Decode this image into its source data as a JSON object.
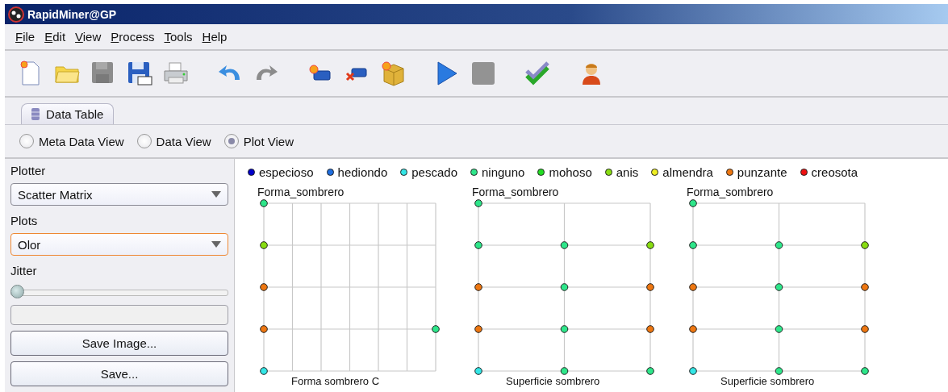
{
  "window": {
    "title": "RapidMiner@GP"
  },
  "menu": [
    {
      "label": "File"
    },
    {
      "label": "Edit"
    },
    {
      "label": "View"
    },
    {
      "label": "Process"
    },
    {
      "label": "Tools"
    },
    {
      "label": "Help"
    }
  ],
  "toolbar": [
    {
      "kind": "new",
      "disabled": false
    },
    {
      "kind": "open",
      "disabled": false
    },
    {
      "kind": "save",
      "disabled": true
    },
    {
      "kind": "saveas",
      "disabled": false
    },
    {
      "kind": "print",
      "disabled": false
    },
    {
      "kind": "gap"
    },
    {
      "kind": "undo",
      "disabled": false
    },
    {
      "kind": "redo",
      "disabled": true
    },
    {
      "kind": "gap"
    },
    {
      "kind": "newop",
      "disabled": false
    },
    {
      "kind": "delop",
      "disabled": false
    },
    {
      "kind": "box",
      "disabled": false
    },
    {
      "kind": "gap"
    },
    {
      "kind": "run",
      "disabled": false
    },
    {
      "kind": "stop",
      "disabled": true
    },
    {
      "kind": "gap"
    },
    {
      "kind": "check",
      "disabled": false
    },
    {
      "kind": "gap"
    },
    {
      "kind": "user",
      "disabled": false
    }
  ],
  "tabs": [
    {
      "label": "Data Table",
      "selected": true
    }
  ],
  "views": [
    {
      "label": "Meta Data View",
      "selected": false
    },
    {
      "label": "Data View",
      "selected": false
    },
    {
      "label": "Plot View",
      "selected": true
    }
  ],
  "sidebar": {
    "plotter_label": "Plotter",
    "plotter": "Scatter Matrix",
    "plots_label": "Plots",
    "plots": "Olor",
    "plots_focused": true,
    "jitter_label": "Jitter",
    "jitter": {
      "level": 0
    },
    "buttons": [
      "Save Image...",
      "Save..."
    ]
  },
  "legend": [
    {
      "label": "especioso",
      "color": "#0000cc"
    },
    {
      "label": "hediondo",
      "color": "#1e6ee0"
    },
    {
      "label": "pescado",
      "color": "#33e6e6"
    },
    {
      "label": "ninguno",
      "color": "#2ee68a"
    },
    {
      "label": "mohoso",
      "color": "#22dd22"
    },
    {
      "label": "anis",
      "color": "#88dd11"
    },
    {
      "label": "almendra",
      "color": "#eeee22"
    },
    {
      "label": "punzante",
      "color": "#ee7711"
    },
    {
      "label": "creosota",
      "color": "#ee1111"
    }
  ],
  "plots": [
    {
      "title": "Forma_sombrero",
      "xlabel": "Forma sombrero C"
    },
    {
      "title": "Forma_sombrero",
      "xlabel": "Superficie sombrero"
    },
    {
      "title": "Forma_sombrero",
      "xlabel": "Superficie sombrero"
    }
  ]
}
